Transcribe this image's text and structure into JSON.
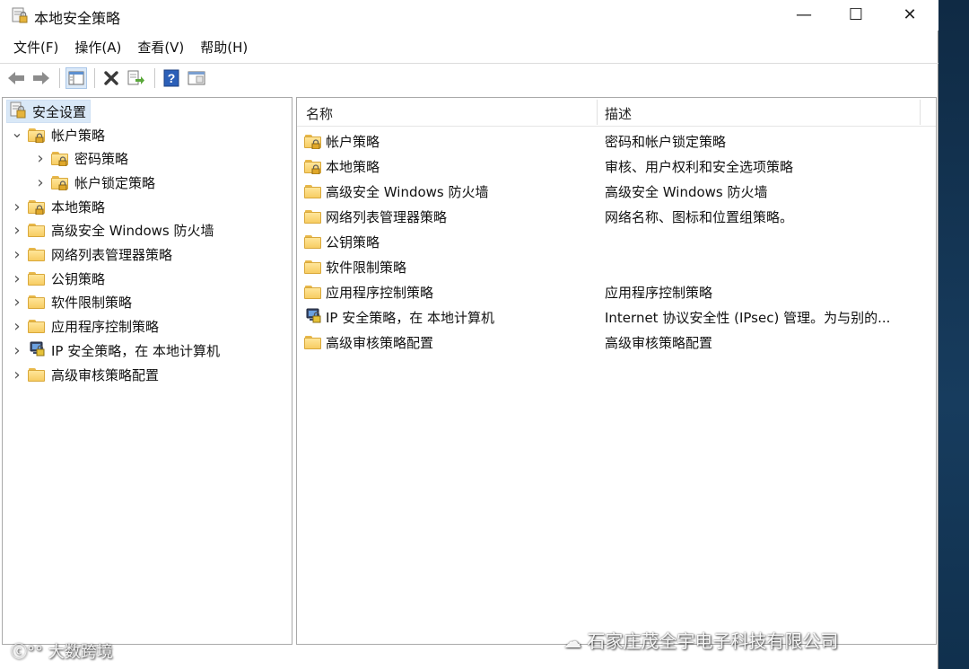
{
  "window": {
    "title": "本地安全策略",
    "minimize": "—",
    "maximize": "☐",
    "close": "✕"
  },
  "menu": {
    "items": [
      "文件(F)",
      "操作(A)",
      "查看(V)",
      "帮助(H)"
    ]
  },
  "toolbar": {
    "icons": [
      "back-arrow-icon",
      "forward-arrow-icon",
      "show-hide-tree-icon",
      "delete-icon",
      "export-list-icon",
      "help-icon",
      "console-view-icon"
    ]
  },
  "tree": {
    "root": "安全设置",
    "items": [
      {
        "label": "帐户策略",
        "expanded": true,
        "level": 1,
        "icon": "locked-folder-icon"
      },
      {
        "label": "密码策略",
        "level": 2,
        "icon": "locked-folder-icon"
      },
      {
        "label": "帐户锁定策略",
        "level": 2,
        "icon": "locked-folder-icon"
      },
      {
        "label": "本地策略",
        "level": 1,
        "icon": "locked-folder-icon"
      },
      {
        "label": "高级安全 Windows 防火墙",
        "level": 1,
        "icon": "folder-icon"
      },
      {
        "label": "网络列表管理器策略",
        "level": 1,
        "icon": "folder-icon"
      },
      {
        "label": "公钥策略",
        "level": 1,
        "icon": "folder-icon"
      },
      {
        "label": "软件限制策略",
        "level": 1,
        "icon": "folder-icon"
      },
      {
        "label": "应用程序控制策略",
        "level": 1,
        "icon": "folder-icon"
      },
      {
        "label": "IP 安全策略，在 本地计算机",
        "level": 1,
        "icon": "ip-security-icon"
      },
      {
        "label": "高级审核策略配置",
        "level": 1,
        "icon": "folder-icon"
      }
    ]
  },
  "list": {
    "columns": {
      "name": "名称",
      "description": "描述"
    },
    "rows": [
      {
        "name": "帐户策略",
        "description": "密码和帐户锁定策略",
        "icon": "locked-folder-icon"
      },
      {
        "name": "本地策略",
        "description": "审核、用户权利和安全选项策略",
        "icon": "locked-folder-icon"
      },
      {
        "name": "高级安全 Windows 防火墙",
        "description": "高级安全 Windows 防火墙",
        "icon": "folder-icon"
      },
      {
        "name": "网络列表管理器策略",
        "description": "网络名称、图标和位置组策略。",
        "icon": "folder-icon"
      },
      {
        "name": "公钥策略",
        "description": "",
        "icon": "folder-icon"
      },
      {
        "name": "软件限制策略",
        "description": "",
        "icon": "folder-icon"
      },
      {
        "name": "应用程序控制策略",
        "description": "应用程序控制策略",
        "icon": "folder-icon"
      },
      {
        "name": "IP 安全策略，在 本地计算机",
        "description": "Internet 协议安全性 (IPsec) 管理。为与别的...",
        "icon": "ip-security-icon"
      },
      {
        "name": "高级审核策略配置",
        "description": "高级审核策略配置",
        "icon": "folder-icon"
      }
    ]
  },
  "watermarks": {
    "left": "大数跨境",
    "right": "石家庄茂全宇电子科技有限公司"
  }
}
